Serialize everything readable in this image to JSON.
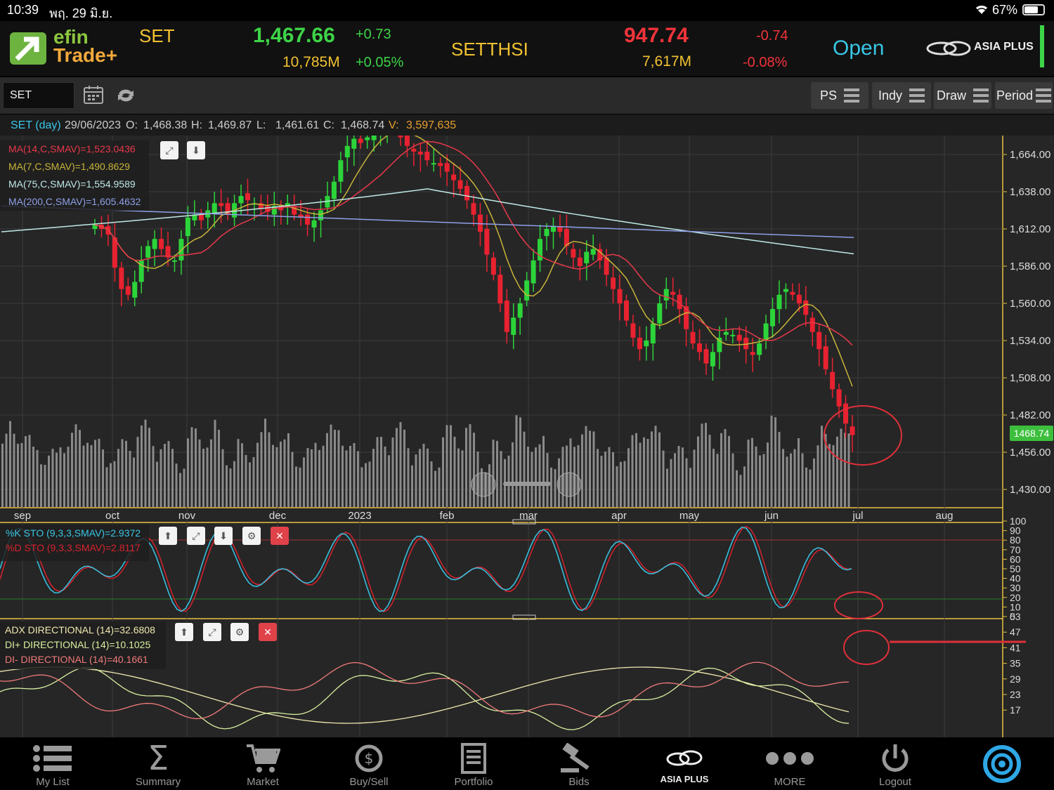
{
  "status_bar": {
    "time": "10:39",
    "date": "พฤ. 29 มิ.ย.",
    "battery": "67%"
  },
  "header": {
    "logo_top": "efin",
    "logo_bottom": "Trade+",
    "index1": {
      "name": "SET",
      "value": "1,467.66",
      "change": "+0.73",
      "volume": "10,785M",
      "pct": "+0.05%"
    },
    "index2": {
      "name": "SETTHSI",
      "value": "947.74",
      "change": "-0.74",
      "volume": "7,617M",
      "pct": "-0.08%"
    },
    "market_status": "Open",
    "broker": "ASIA PLUS"
  },
  "toolbar": {
    "symbol_value": "SET",
    "buttons": [
      "PS",
      "Indy",
      "Draw",
      "Period"
    ]
  },
  "info": {
    "symbol": "SET (day)",
    "date": "29/06/2023",
    "o_label": "O:",
    "o": "1,468.38",
    "h_label": "H:",
    "h": "1,469.87",
    "l_label": "L:",
    "l": "1,461.61",
    "c_label": "C:",
    "c": "1,468.74",
    "v_label": "V:",
    "v": "3,597,635"
  },
  "main_legend": [
    {
      "text": "MA(14,C,SMAV)=1,523.0436",
      "color": "#e8384a"
    },
    {
      "text": "MA(7,C,SMAV)=1,490.8629",
      "color": "#c8b43a"
    },
    {
      "text": "MA(75,C,SMAV)=1,554.9589",
      "color": "#bfe8e6"
    },
    {
      "text": "MA(200,C,SMAV)=1,605.4632",
      "color": "#8fa0e8"
    }
  ],
  "sto_legend": [
    {
      "text": "%K STO (9,3,3,SMAV)=2.9372",
      "color": "#39c6e6"
    },
    {
      "text": "%D STO (9,3,3,SMAV)=2.8117",
      "color": "#d8222e"
    }
  ],
  "adx_legend": [
    {
      "text": "ADX DIRECTIONAL (14)=32.6808",
      "color": "#f0e8b0"
    },
    {
      "text": "DI+ DIRECTIONAL (14)=10.1025",
      "color": "#d8f0a0"
    },
    {
      "text": "DI- DIRECTIONAL (14)=40.1661",
      "color": "#f07a7a"
    }
  ],
  "chart_data": {
    "type": "candlestick",
    "price_axis_ticks": [
      "1,664.00",
      "1,638.00",
      "1,612.00",
      "1,586.00",
      "1,560.00",
      "1,534.00",
      "1,508.00",
      "1,482.00",
      "1,456.00",
      "1,430.00"
    ],
    "current_price_label": "1468.74",
    "x_ticks": [
      "sep",
      "oct",
      "nov",
      "dec",
      "2023",
      "feb",
      "mar",
      "apr",
      "may",
      "jun",
      "jul",
      "aug"
    ],
    "sto_axis_ticks": [
      "100",
      "90",
      "80",
      "70",
      "60",
      "50",
      "40",
      "30",
      "20",
      "10",
      "0"
    ],
    "adx_axis_ticks": [
      "53",
      "47",
      "41",
      "35",
      "29",
      "23",
      "17"
    ],
    "close_series": [
      1615,
      1612,
      1608,
      1585,
      1570,
      1566,
      1575,
      1590,
      1600,
      1605,
      1598,
      1592,
      1590,
      1605,
      1620,
      1622,
      1618,
      1625,
      1630,
      1628,
      1622,
      1630,
      1635,
      1632,
      1630,
      1626,
      1624,
      1628,
      1625,
      1630,
      1622,
      1620,
      1615,
      1618,
      1625,
      1635,
      1645,
      1660,
      1670,
      1675,
      1672,
      1676,
      1680,
      1682,
      1686,
      1684,
      1676,
      1670,
      1666,
      1664,
      1660,
      1658,
      1656,
      1652,
      1646,
      1640,
      1632,
      1622,
      1610,
      1594,
      1580,
      1560,
      1540,
      1550,
      1560,
      1576,
      1590,
      1605,
      1612,
      1614,
      1610,
      1600,
      1592,
      1586,
      1596,
      1598,
      1590,
      1580,
      1570,
      1560,
      1548,
      1536,
      1528,
      1534,
      1546,
      1560,
      1570,
      1566,
      1556,
      1542,
      1532,
      1526,
      1518,
      1526,
      1536,
      1540,
      1538,
      1534,
      1528,
      1524,
      1532,
      1546,
      1556,
      1566,
      1570,
      1566,
      1560,
      1552,
      1540,
      1528,
      1514,
      1500,
      1488,
      1476,
      1468
    ]
  },
  "nav": [
    {
      "label": "My List",
      "icon": "list-icon"
    },
    {
      "label": "Summary",
      "icon": "sigma-icon"
    },
    {
      "label": "Market",
      "icon": "cart-icon"
    },
    {
      "label": "Buy/Sell",
      "icon": "dollar-refresh-icon"
    },
    {
      "label": "Portfolio",
      "icon": "document-icon"
    },
    {
      "label": "Bids",
      "icon": "gavel-icon"
    },
    {
      "label": "ASIA PLUS",
      "icon": "asiaplus-logo"
    },
    {
      "label": "MORE",
      "icon": "dots-icon"
    },
    {
      "label": "Logout",
      "icon": "power-icon"
    }
  ]
}
